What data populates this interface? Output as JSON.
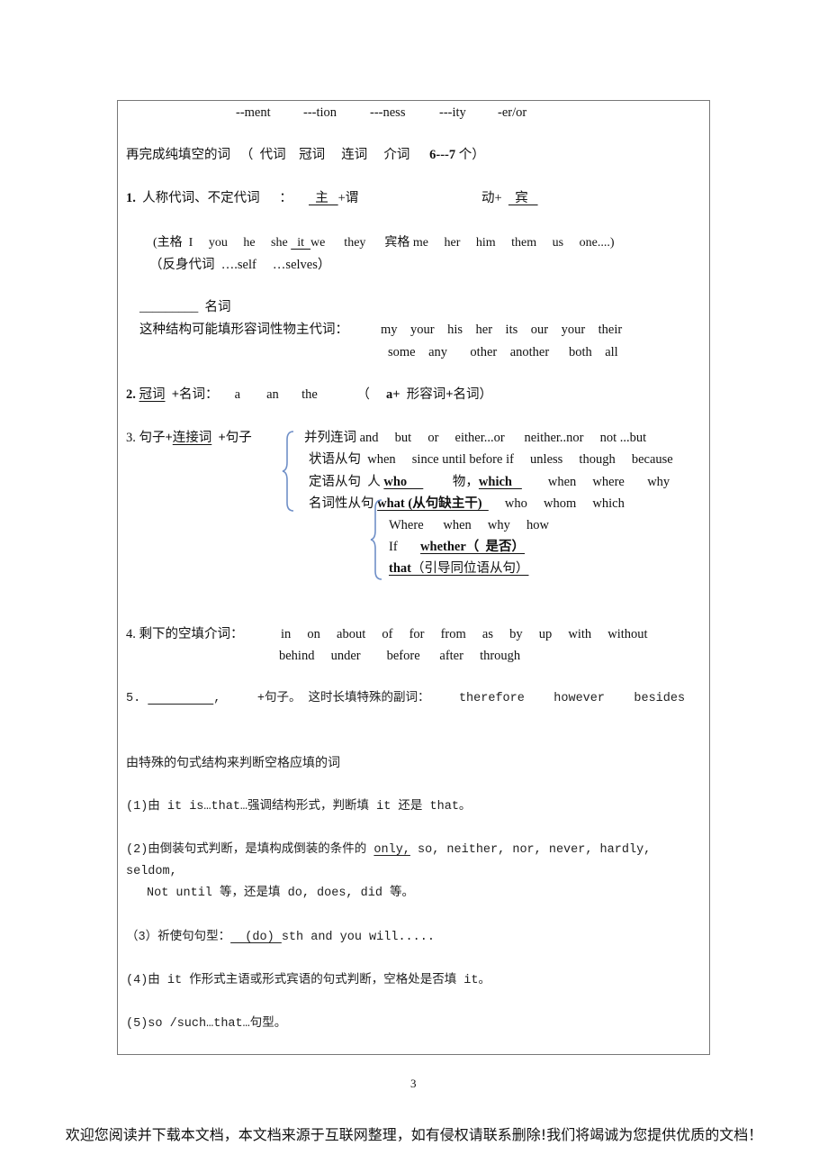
{
  "suffixes": [
    "--ment",
    "---tion",
    "---ness",
    "---ity",
    "-er/or"
  ],
  "lines": {
    "l1": [
      {
        "t": "再完成纯填空的词   （  代词    冠词     连词     介词      "
      },
      {
        "t": "6---7",
        "b": 1
      },
      {
        "t": " 个）"
      }
    ],
    "l2": [
      {
        "t": "1.",
        "b": 1
      },
      {
        "t": "  人称代词、不定代词      ：     "
      },
      {
        "t": "  主   ",
        "u": 1
      },
      {
        "t": "+谓"
      }
    ],
    "l2b": [
      {
        "t": "动+  "
      },
      {
        "t": "  宾   ",
        "u": 1
      }
    ],
    "l3": [
      {
        "t": "(主格  I     you     he     she "
      },
      {
        "t": "  it  ",
        "u": 1
      },
      {
        "t": "we      they      宾格 me     her     him     them     us     one....)"
      }
    ],
    "l4": [
      {
        "t": "（反身代词  ….self     …selves）"
      }
    ],
    "l5": [
      {
        "t": "_________ "
      },
      {
        "t": " 名词"
      }
    ],
    "l6": [
      {
        "t": "这种结构可能填形容词性物主代词："
      }
    ],
    "l6b": [
      {
        "t": "my    your    his    her    its    our    your    their"
      }
    ],
    "l7": [
      {
        "t": "some    any       other    another      both    all"
      }
    ],
    "l8": [
      {
        "t": "2.",
        "b": 1
      },
      {
        "t": " "
      },
      {
        "t": "冠词",
        "u": 1
      },
      {
        "t": "  "
      },
      {
        "t": "+",
        "b": 1
      },
      {
        "t": "名词：     a        an       the            （     "
      },
      {
        "t": "a+",
        "b": 1
      },
      {
        "t": "  形容词"
      },
      {
        "t": "+",
        "b": 1
      },
      {
        "t": "名词）"
      }
    ],
    "l9": [
      {
        "t": "3. 句子"
      },
      {
        "t": "+",
        "b": 1
      },
      {
        "t": "连接词",
        "u": 1
      },
      {
        "t": "  "
      },
      {
        "t": "+",
        "b": 1
      },
      {
        "t": "句子"
      }
    ],
    "l9b": [
      {
        "t": "并列连词 and     but     or     either...or      neither..nor     not ...but"
      }
    ],
    "l10": [
      {
        "t": "状语从句  when     since until before if     unless     though     because"
      }
    ],
    "l11": [
      {
        "t": "定语从句  人 "
      },
      {
        "t": "who     ",
        "b": 1,
        "u": 1
      },
      {
        "t": "         物，"
      },
      {
        "t": "which   ",
        "b": 1,
        "u": 1
      },
      {
        "t": "        when     where       why"
      }
    ],
    "l12": [
      {
        "t": "名词性从句 "
      },
      {
        "t": "what (从句缺主干)  ",
        "b": 1,
        "u": 1
      },
      {
        "t": "     who     whom     which"
      }
    ],
    "l13": [
      {
        "t": "Where      when     why     how"
      }
    ],
    "l14": [
      {
        "t": "If       "
      },
      {
        "t": "whether（  是否）",
        "b": 1,
        "u": 1
      }
    ],
    "l15": [
      {
        "t": "that",
        "b": 1,
        "u": 1
      },
      {
        "t": "（引导同位语从句）",
        "u": 1
      }
    ],
    "l16": [
      {
        "t": "4. 剩下的空填介词："
      }
    ],
    "l16b": [
      {
        "t": "in     on     about     of     for     from     as     by     up     with     without"
      }
    ],
    "l17": [
      {
        "t": "behind     under        before      after     through"
      }
    ],
    "l18": [
      {
        "t": "5. "
      },
      {
        "t": "         ",
        "u": 1
      },
      {
        "t": ",     +句子。 这时长填特殊的副词：    therefore    however    besides"
      }
    ],
    "l19": [
      {
        "t": "由特殊的句式结构来判断空格应填的词"
      }
    ],
    "l20": [
      {
        "t": "(1)由 it is…that…强调结构形式，判断填 it 还是 that。"
      }
    ],
    "l21": [
      {
        "t": "(2)由倒装句式判断，是填构成倒装的条件的 "
      },
      {
        "t": "only,",
        "u": 1
      },
      {
        "t": " so, neither, nor, never, hardly,"
      }
    ],
    "l22": [
      {
        "t": "seldom,"
      }
    ],
    "l23": [
      {
        "t": "Not until 等，还是填 do, does, did 等。"
      }
    ],
    "l24": [
      {
        "t": "（3）祈使句句型："
      },
      {
        "t": "  (do) ",
        "u": 1
      },
      {
        "t": "sth and you will....."
      }
    ],
    "l25": [
      {
        "t": "(4)由 it 作形式主语或形式宾语的句式判断，空格处是否填 it。"
      }
    ],
    "l26": [
      {
        "t": "(5)so /such…that…句型。"
      }
    ]
  },
  "page_number": "3",
  "footer": "欢迎您阅读并下载本文档，本文档来源于互联网整理，如有侵权请联系删除!我们将竭诚为您提供优质的文档！",
  "colors": {
    "brace": "#6f8fc7",
    "border": "#777777"
  }
}
